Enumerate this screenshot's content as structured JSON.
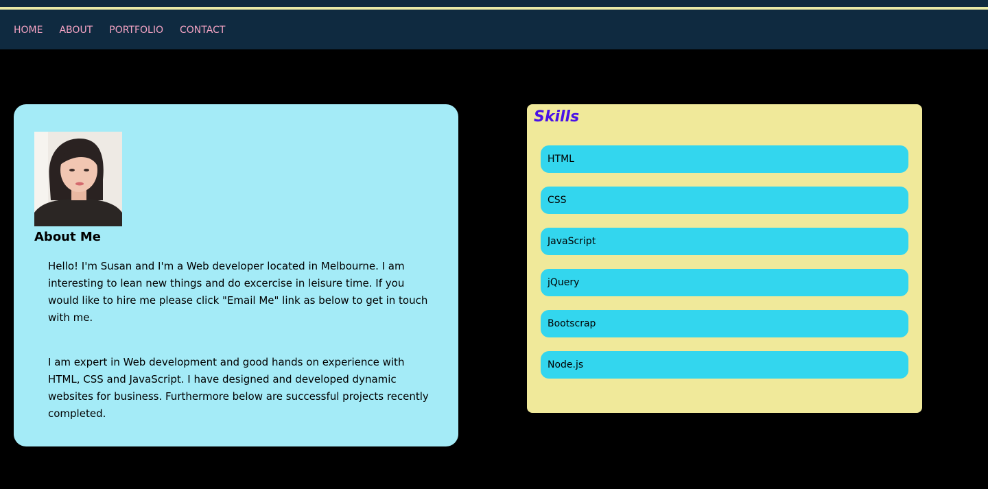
{
  "colors": {
    "page_background": "#000000",
    "navbar_background": "#0f2a40",
    "navbar_stripe": "#e9eaa8",
    "nav_link": "#f5a4c4",
    "about_card": "#a4ebf7",
    "skills_card": "#f0e99a",
    "skills_title": "#4a12e6",
    "skill_pill": "#33d6ee"
  },
  "nav": {
    "items": [
      {
        "label": "HOME"
      },
      {
        "label": "ABOUT"
      },
      {
        "label": "PORTFOLIO"
      },
      {
        "label": "CONTACT"
      }
    ]
  },
  "about": {
    "title": "About Me",
    "paragraph1": "Hello! I'm Susan and I'm a Web developer located in Melbourne. I am interesting to lean new things and do excercise in leisure time. If you would like to hire me please click \"Email Me\" link as below to get in touch with me.",
    "paragraph2": "I am expert in Web development and good hands on experience with HTML, CSS and JavaScript. I have designed and developed dynamic websites for business. Furthermore below are successful projects recently completed."
  },
  "skills": {
    "title": "Skills",
    "items": [
      {
        "label": "HTML"
      },
      {
        "label": "CSS"
      },
      {
        "label": "JavaScript"
      },
      {
        "label": "jQuery"
      },
      {
        "label": "Bootscrap"
      },
      {
        "label": "Node.js"
      }
    ]
  }
}
